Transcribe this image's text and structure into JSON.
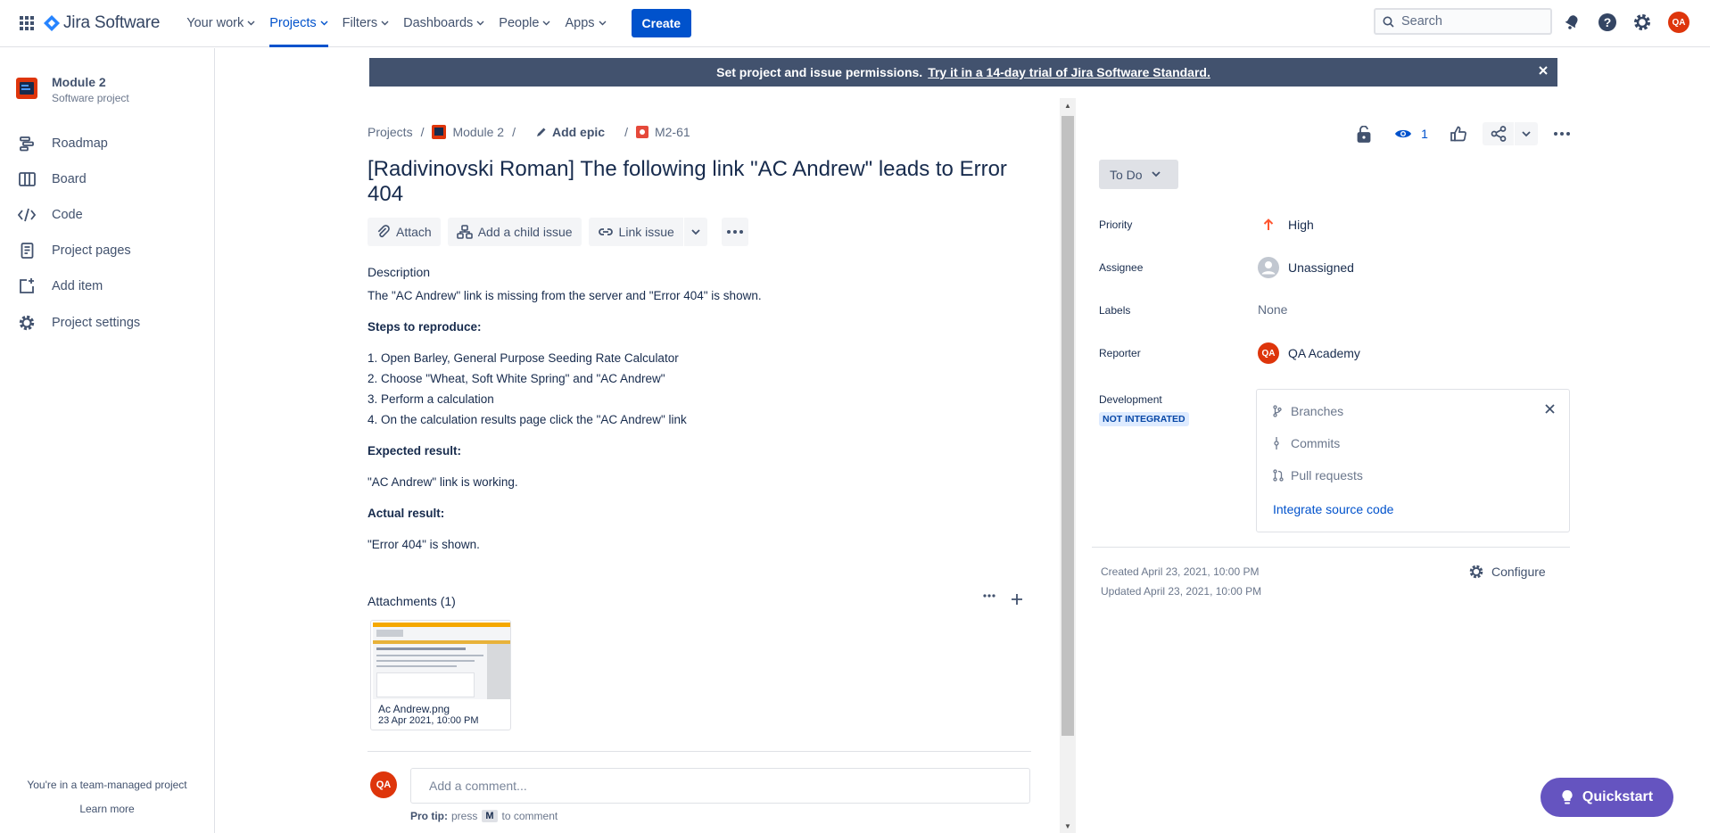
{
  "topnav": {
    "logo_text": "Jira Software",
    "items": [
      {
        "label": "Your work"
      },
      {
        "label": "Projects"
      },
      {
        "label": "Filters"
      },
      {
        "label": "Dashboards"
      },
      {
        "label": "People"
      },
      {
        "label": "Apps"
      }
    ],
    "create_label": "Create",
    "search_placeholder": "Search",
    "user_initials": "QA"
  },
  "sidebar": {
    "project_name": "Module 2",
    "project_type": "Software project",
    "items": [
      {
        "label": "Roadmap",
        "icon": "roadmap-icon"
      },
      {
        "label": "Board",
        "icon": "board-icon"
      },
      {
        "label": "Code",
        "icon": "code-icon"
      },
      {
        "label": "Project pages",
        "icon": "pages-icon"
      },
      {
        "label": "Add item",
        "icon": "add-item-icon"
      },
      {
        "label": "Project settings",
        "icon": "gear-icon"
      }
    ],
    "footer_text": "You're in a team-managed project",
    "footer_link": "Learn more"
  },
  "banner": {
    "text": "Set project and issue permissions.",
    "link": "Try it in a 14-day trial of Jira Software Standard."
  },
  "breadcrumbs": {
    "projects": "Projects",
    "project": "Module 2",
    "epic": "Add epic",
    "issue_key": "M2-61"
  },
  "issue": {
    "title": "[Radivinovski Roman] The following link \"AC Andrew\" leads to Error 404",
    "actions": {
      "attach": "Attach",
      "child": "Add a child issue",
      "link": "Link issue"
    },
    "description_label": "Description",
    "description_text": "The \"AC Andrew\" link is missing from the server and \"Error 404\" is shown.",
    "steps_label": "Steps to reproduce:",
    "steps": [
      "1. Open Barley, General Purpose Seeding Rate Calculator",
      "2. Choose \"Wheat, Soft White Spring\" and \"AC Andrew\"",
      "3. Perform a calculation",
      "4. On the calculation results page click the \"AC Andrew\" link"
    ],
    "expected_label": "Expected result:",
    "expected_text": "\"AC Andrew\" link is working.",
    "actual_label": "Actual result:",
    "actual_text": "\"Error 404\" is shown.",
    "attachments_label": "Attachments (1)",
    "attachment": {
      "name": "Ac Andrew.png",
      "date": "23 Apr 2021, 10:00 PM"
    },
    "comment_placeholder": "Add a comment...",
    "protip_label": "Pro tip:",
    "protip_press": "press",
    "protip_key": "M",
    "protip_suffix": "to comment"
  },
  "details": {
    "watchers": "1",
    "status": "To Do",
    "priority_label": "Priority",
    "priority_value": "High",
    "assignee_label": "Assignee",
    "assignee_value": "Unassigned",
    "labels_label": "Labels",
    "labels_value": "None",
    "reporter_label": "Reporter",
    "reporter_value": "QA Academy",
    "reporter_initials": "QA",
    "development_label": "Development",
    "development_badge": "NOT INTEGRATED",
    "dev_items": [
      "Branches",
      "Commits",
      "Pull requests"
    ],
    "dev_link": "Integrate source code",
    "created": "Created April 23, 2021, 10:00 PM",
    "updated": "Updated April 23, 2021, 10:00 PM",
    "configure": "Configure"
  },
  "quickstart": "Quickstart",
  "colors": {
    "brand_blue": "#0052cc",
    "banner_bg": "#42526e",
    "issue_type_red": "#e5493a",
    "quickstart_purple": "#6554c0"
  }
}
